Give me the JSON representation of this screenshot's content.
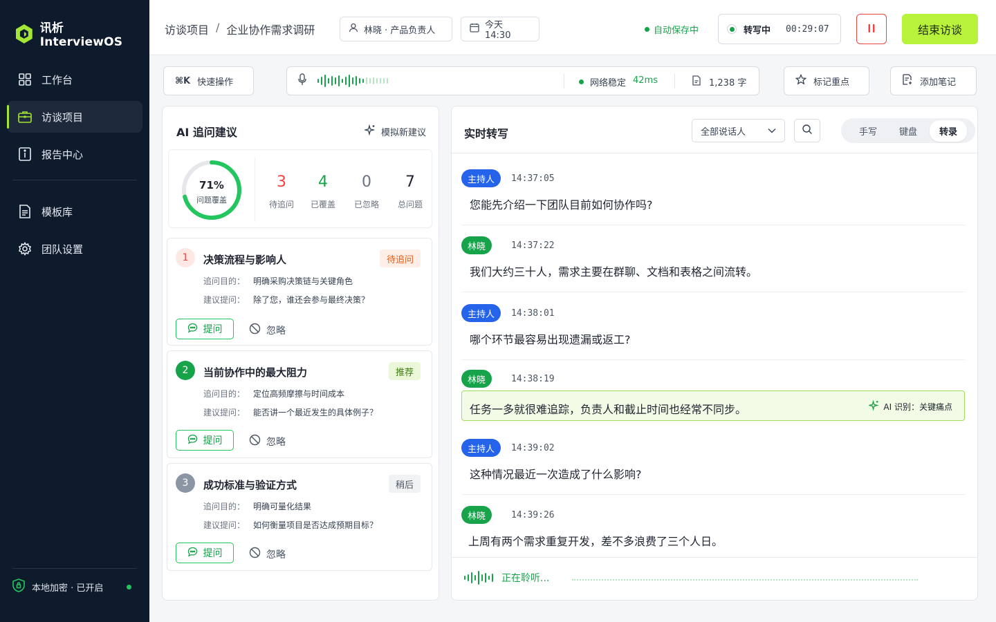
{
  "brand": {
    "name": "讯析 InterviewOS"
  },
  "sidebar": {
    "items": [
      {
        "label": "工作台",
        "icon": "grid-icon"
      },
      {
        "label": "访谈项目",
        "icon": "briefcase-icon",
        "active": true
      },
      {
        "label": "报告中心",
        "icon": "report-icon"
      },
      {
        "label": "模板库",
        "icon": "document-icon"
      },
      {
        "label": "团队设置",
        "icon": "gear-icon"
      }
    ],
    "footer": {
      "label": "本地加密 · 已开启",
      "icon": "shield-icon"
    }
  },
  "header": {
    "breadcrumb": {
      "root": "访谈项目",
      "separator": "/",
      "current": "企业协作需求调研"
    },
    "participant": "林晓 · 产品负责人",
    "schedule": "今天 14:30",
    "autosave": "自动保存中",
    "recording": {
      "label": "转写中",
      "time": "00:29:07"
    },
    "end_button": "结束访谈"
  },
  "toolbar": {
    "quick": {
      "shortcut": "⌘K",
      "label": "快速操作"
    },
    "network": {
      "label": "网络稳定",
      "latency": "42ms"
    },
    "word_count": "1,238 字",
    "mark_button": "标记重点",
    "note_button": "添加笔记"
  },
  "ai_panel": {
    "title": "AI 追问建议",
    "simulate": "模拟新建议",
    "coverage": {
      "percent": 71,
      "percent_label": "71%",
      "label": "问题覆盖"
    },
    "stats": [
      {
        "value": "3",
        "label": "待追问",
        "color": "#ef4444"
      },
      {
        "value": "4",
        "label": "已覆盖",
        "color": "#16a34a"
      },
      {
        "value": "0",
        "label": "已忽略",
        "color": "#6b7280"
      },
      {
        "value": "7",
        "label": "总问题",
        "color": "#1f2430"
      }
    ],
    "cards": [
      {
        "num": "1",
        "title": "决策流程与影响人",
        "tag": "待追问",
        "purpose_key": "追问目的：",
        "purpose": "明确采购决策链与关键角色",
        "suggest_key": "建议提问：",
        "suggest": "除了您，谁还会参与最终决策？",
        "ask": "提问",
        "ignore": "忽略"
      },
      {
        "num": "2",
        "title": "当前协作中的最大阻力",
        "tag": "推荐",
        "purpose_key": "追问目的：",
        "purpose": "定位高频摩擦与时间成本",
        "suggest_key": "建议提问：",
        "suggest": "能否讲一个最近发生的具体例子？",
        "ask": "提问",
        "ignore": "忽略"
      },
      {
        "num": "3",
        "title": "成功标准与验证方式",
        "tag": "稍后",
        "purpose_key": "追问目的：",
        "purpose": "明确可量化结果",
        "suggest_key": "建议提问：",
        "suggest": "如何衡量项目是否达成预期目标？",
        "ask": "提问",
        "ignore": "忽略"
      }
    ]
  },
  "transcript": {
    "title": "实时转写",
    "filter": "全部说话人",
    "modes": [
      "手写",
      "键盘",
      "转录"
    ],
    "active_mode": "转录",
    "messages": [
      {
        "speaker": "主持人",
        "time": "14:37:05",
        "text": "您能先介绍一下团队目前如何协作吗?"
      },
      {
        "speaker": "林晓",
        "time": "14:37:22",
        "text": "我们大约三十人，需求主要在群聊、文档和表格之间流转。"
      },
      {
        "speaker": "主持人",
        "time": "14:38:01",
        "text": "哪个环节最容易出现遗漏或返工?"
      },
      {
        "speaker": "林晓",
        "time": "14:38:19",
        "text": "任务一多就很难追踪，负责人和截止时间也经常不同步。",
        "ai_label": "AI 识别：关键痛点"
      },
      {
        "speaker": "主持人",
        "time": "14:39:02",
        "text": "这种情况最近一次造成了什么影响?"
      },
      {
        "speaker": "林晓",
        "time": "14:39:26",
        "text": "上周有两个需求重复开发，差不多浪费了三个人日。"
      }
    ],
    "listening": "正在聆听..."
  },
  "colors": {
    "accent": "#b9f23b",
    "host": "#2563eb",
    "guest": "#16a34a",
    "sidebar": "#0e1b2c"
  }
}
